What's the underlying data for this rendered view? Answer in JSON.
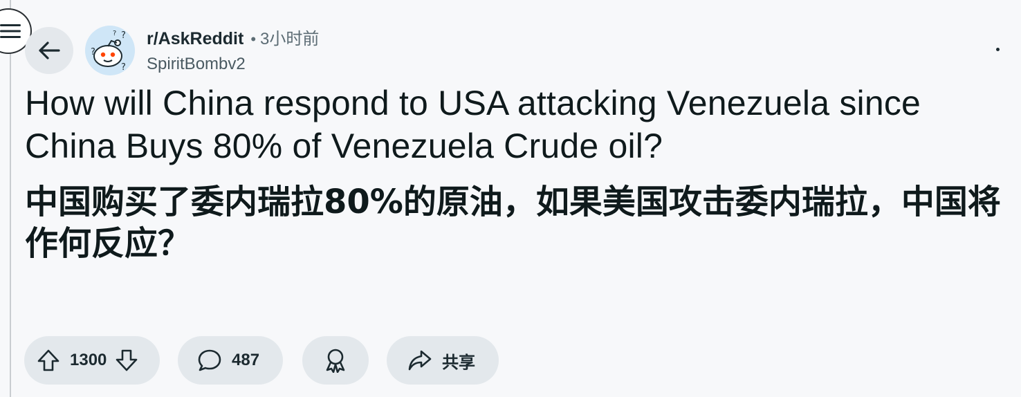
{
  "post": {
    "subreddit": "r/AskReddit",
    "separator": "•",
    "time": "3小时前",
    "author": "SpiritBombv2",
    "title_en": "How will China respond to USA attacking Venezuela since China Buys 80% of Venezuela Crude oil?",
    "title_zh": "中国购买了委内瑞拉80%的原油，如果美国攻击委内瑞拉，中国将作何反应？"
  },
  "actions": {
    "upvotes": "1300",
    "comments": "487",
    "share_label": "共享"
  },
  "icons": {
    "menu": "hamburger-menu-icon",
    "back": "back-arrow-icon",
    "avatar": "subreddit-avatar-icon",
    "more": "more-options-icon",
    "upvote": "upvote-arrow-icon",
    "downvote": "downvote-arrow-icon",
    "comment": "comment-bubble-icon",
    "award": "award-icon",
    "share": "share-arrow-icon"
  },
  "colors": {
    "background": "#f7f8fa",
    "pill": "#e3e8ec",
    "text": "#0f1a1c",
    "meta": "#5c6c74"
  }
}
